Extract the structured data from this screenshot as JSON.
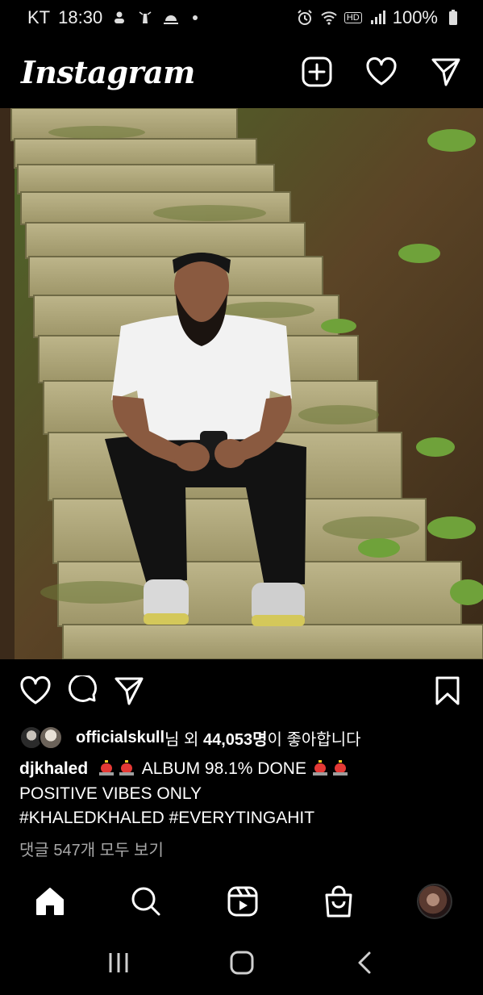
{
  "status_bar": {
    "carrier": "KT",
    "time": "18:30",
    "battery": "100%",
    "hd_label": "HD"
  },
  "header": {
    "logo": "Instagram"
  },
  "post": {
    "liked_by_user": "officialskull",
    "likes_prefix_suffix": "님 외",
    "likes_count": "44,053명",
    "likes_suffix": "이 좋아합니다",
    "caption_user": "djkhaled",
    "caption_line1": "ALBUM 98.1% DONE",
    "caption_line2": "POSITIVE VIBES ONLY",
    "caption_line3": "#KHALEDKHALED #EVERYTINGAHIT",
    "view_comments": "댓글 547개 모두 보기"
  },
  "colors": {
    "background": "#000000",
    "text": "#ffffff",
    "muted": "#a8a8a8"
  }
}
